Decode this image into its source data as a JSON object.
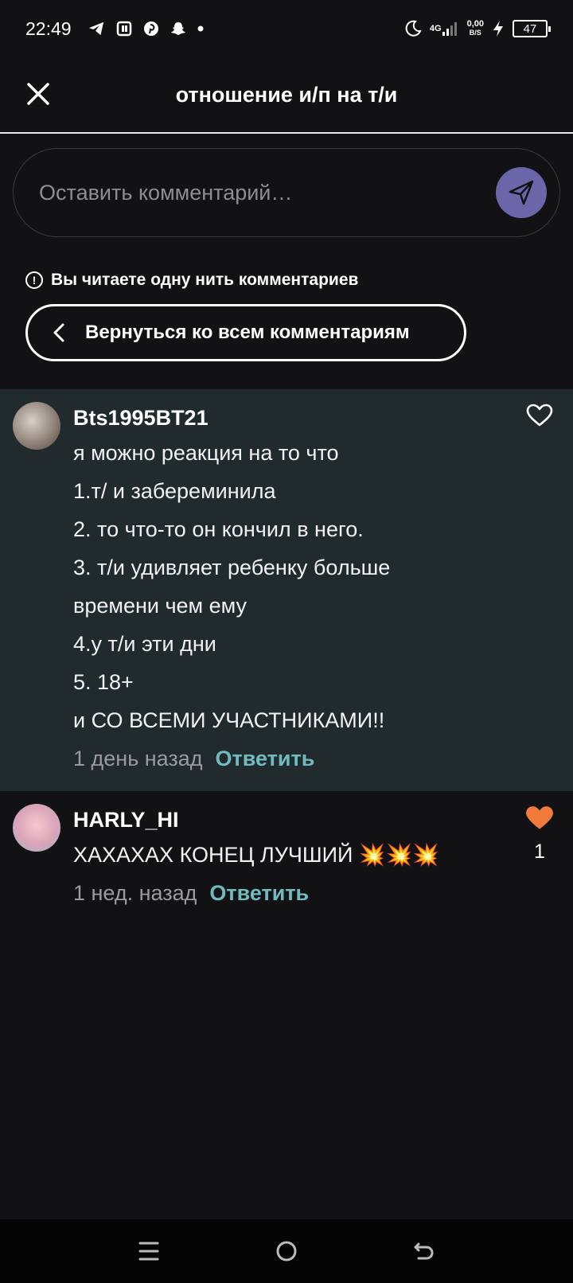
{
  "status_bar": {
    "time": "22:49",
    "network_type": "4G",
    "speed_value": "0,00",
    "speed_unit": "B/S",
    "battery": "47",
    "icons": [
      "telegram-icon",
      "pocket-icon",
      "pinterest-icon",
      "snapchat-icon",
      "dot-icon",
      "moon-icon",
      "signal-icon",
      "charging-icon"
    ]
  },
  "header": {
    "title": "отношение и/п на т/и"
  },
  "comment_input": {
    "placeholder": "Оставить комментарий…"
  },
  "thread": {
    "notice": "Вы читаете одну нить комментариев",
    "back_label": "Вернуться ко всем комментариям"
  },
  "comments": [
    {
      "username": "Bts1995BT21",
      "lines": [
        "я можно реакция на то что",
        "1.т/ и забереминила",
        "2. то что-то он кончил в него.",
        "3. т/и удивляет ребенку больше",
        "времени чем ему",
        "4.у т/и эти дни",
        "5. 18+",
        "и СО ВСЕМИ УЧАСТНИКАМИ!!"
      ],
      "time": "1 день назад",
      "reply_label": "Ответить",
      "liked": false,
      "like_count": ""
    },
    {
      "username": "HARLY_HI",
      "lines": [
        "ХАХАХАХ КОНЕЦ ЛУЧШИЙ 💥💥💥"
      ],
      "time": "1 нед. назад",
      "reply_label": "Ответить",
      "liked": true,
      "like_count": "1"
    }
  ],
  "colors": {
    "background": "#121215",
    "highlight": "#212a2d",
    "accent_reply": "#6fbcc0",
    "send_button": "#6b66a9",
    "heart_liked": "#f27a3a"
  }
}
